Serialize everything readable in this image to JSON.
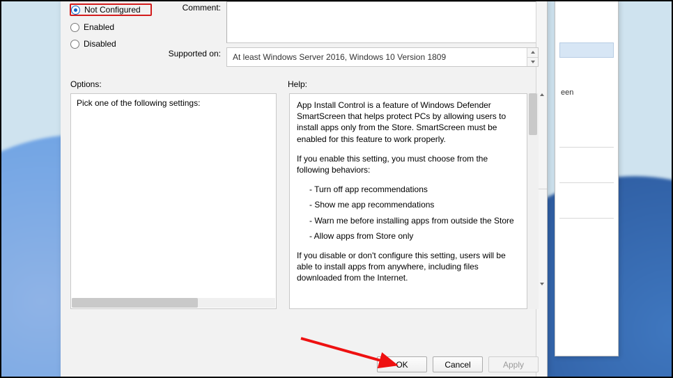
{
  "radio": {
    "not_configured": "Not Configured",
    "enabled": "Enabled",
    "disabled": "Disabled",
    "selected": "not_configured"
  },
  "labels": {
    "comment": "Comment:",
    "supported_on": "Supported on:",
    "options": "Options:",
    "help": "Help:"
  },
  "supported_text": "At least Windows Server 2016, Windows 10 Version 1809",
  "options_text": "Pick one of the following settings:",
  "help": {
    "p1": "App Install Control is a feature of Windows Defender SmartScreen that helps protect PCs by allowing users to install apps only from the Store.  SmartScreen must be enabled for this feature to work properly.",
    "p2": "If you enable this setting, you must choose from the following behaviors:",
    "b1": "- Turn off app recommendations",
    "b2": "- Show me app recommendations",
    "b3": "- Warn me before installing apps from outside the Store",
    "b4": "- Allow apps from Store only",
    "p3": "If you disable or don't configure this setting, users will be able to install apps from anywhere, including files downloaded from the Internet."
  },
  "buttons": {
    "ok": "OK",
    "cancel": "Cancel",
    "apply": "Apply"
  },
  "ghost_label": "een"
}
